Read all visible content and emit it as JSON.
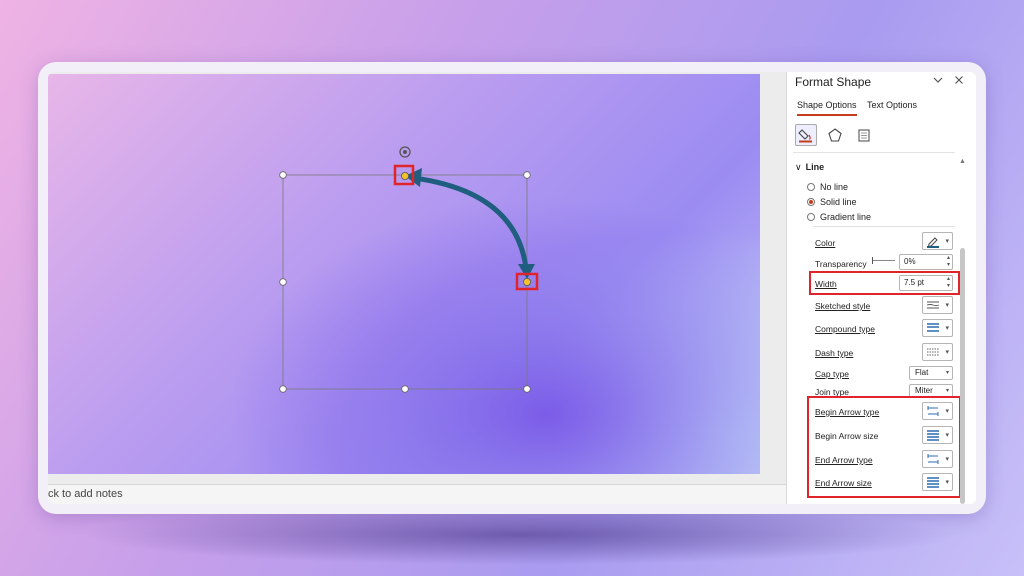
{
  "panel": {
    "title": "Format Shape",
    "collapse_icon": "chevron-down-icon",
    "close_icon": "close-icon",
    "tabs": [
      {
        "label": "Shape Options",
        "active": true
      },
      {
        "label": "Text Options",
        "active": false
      }
    ],
    "category_icons": [
      "fill-line-icon",
      "effects-pentagon-icon",
      "size-properties-icon"
    ],
    "section": {
      "label": "Line",
      "expanded": true,
      "line_options": [
        {
          "label": "No line",
          "selected": false
        },
        {
          "label": "Solid line",
          "selected": true
        },
        {
          "label": "Gradient line",
          "selected": false
        }
      ],
      "color_label": "Color",
      "transparency_label": "Transparency",
      "transparency_value": "0%",
      "width_label": "Width",
      "width_value": "7.5 pt",
      "sketched_label": "Sketched style",
      "compound_label": "Compound type",
      "dash_label": "Dash type",
      "cap_label": "Cap type",
      "cap_value": "Flat",
      "join_label": "Join type",
      "join_value": "Miter",
      "begin_arrow_type_label": "Begin Arrow type",
      "begin_arrow_size_label": "Begin Arrow size",
      "end_arrow_type_label": "End Arrow type",
      "end_arrow_size_label": "End Arrow size"
    }
  },
  "notes": {
    "placeholder": "ck to add notes"
  },
  "colors": {
    "arrow": "#1f5e7e",
    "highlight": "#e0242b",
    "accent": "#c43e1c",
    "handle_endpoint": "#f2c12e"
  }
}
